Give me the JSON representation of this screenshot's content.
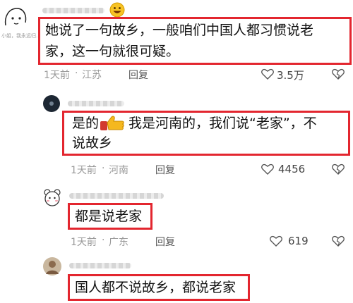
{
  "comments": [
    {
      "text_lines": [
        "她说了一句故乡，一般咱们中国人都习惯说老",
        "家，这一句就很可疑。"
      ],
      "time": "1天前",
      "location": "江苏",
      "reply_label": "回复",
      "likes": "3.5万"
    },
    {
      "text_lines": [
        "我是河南的，我们说“老家”，不",
        "说故乡"
      ],
      "prefix": "是的",
      "time": "1天前",
      "location": "河南",
      "reply_label": "回复",
      "likes": "4456"
    },
    {
      "text_lines": [
        "都是说老家"
      ],
      "time": "1天前",
      "location": "广东",
      "reply_label": "回复",
      "likes": "619"
    },
    {
      "text_lines": [
        "国人都不说故乡，都说老家"
      ]
    }
  ],
  "avatar_caption": "小姐，我永远归...",
  "icons": [
    "avatar-sketch",
    "grinning-emoji",
    "heart-outline",
    "broken-heart",
    "thumbs-up-emoji",
    "bear-avatar",
    "portrait-avatar"
  ],
  "colors": {
    "highlight_box": "#e3262f",
    "meta_text": "#9a9a9a"
  }
}
